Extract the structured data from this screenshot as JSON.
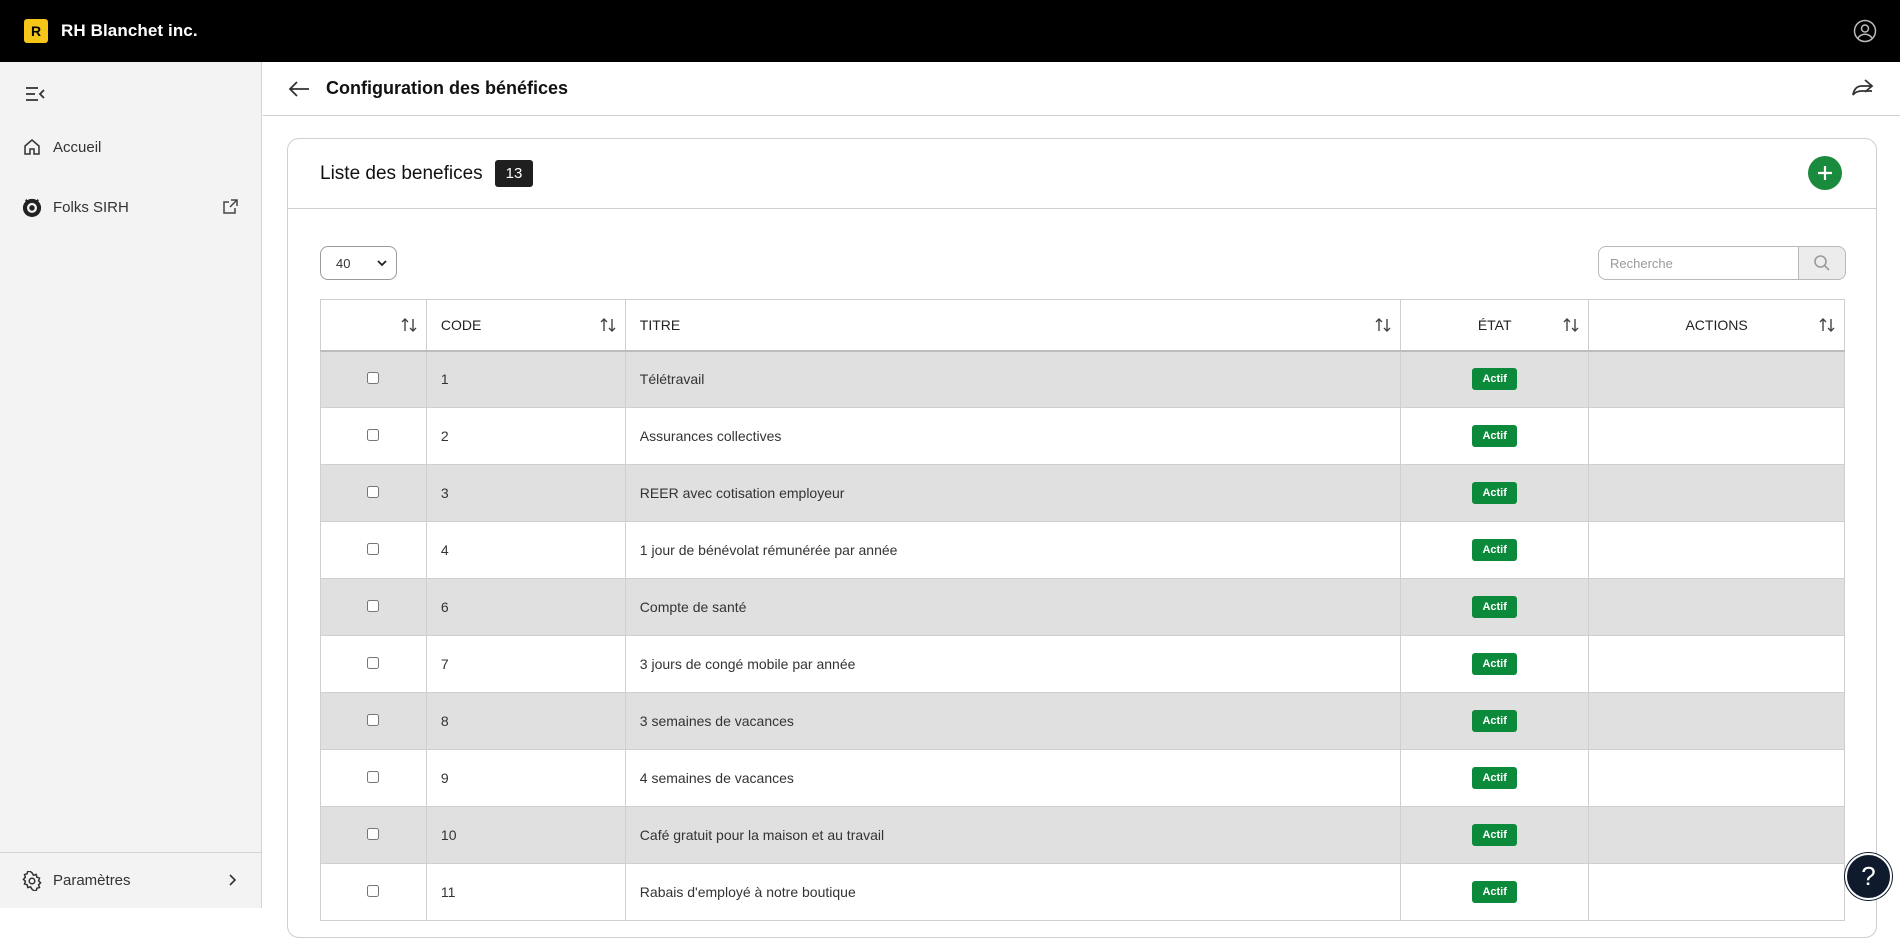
{
  "topbar": {
    "logo_letter": "R",
    "brand_name": "RH Blanchet inc.",
    "icons": {
      "user": "user-circle-icon"
    }
  },
  "sidebar": {
    "collapse_icon": "collapse-menu-icon",
    "items": [
      {
        "label": "Accueil",
        "icon": "home-icon"
      },
      {
        "label": "Folks SIRH",
        "icon": "folks-logo-icon",
        "trailing_icon": "external-link-icon"
      }
    ],
    "footer": {
      "label": "Paramètres",
      "icon": "gear-icon",
      "trailing_icon": "chevron-right-icon"
    }
  },
  "header": {
    "title": "Configuration des bénéfices",
    "back_icon": "arrow-left-icon",
    "share_icon": "share-icon"
  },
  "card": {
    "title": "Liste des benefices",
    "count": "13",
    "add_icon": "plus-icon"
  },
  "controls": {
    "per_page": "40",
    "search_placeholder": "Recherche",
    "search_icon": "search-icon"
  },
  "table": {
    "columns": [
      "",
      "CODE",
      "TITRE",
      "ÉTAT",
      "ACTIONS"
    ],
    "rows": [
      {
        "code": "1",
        "titre": "Télétravail",
        "etat": "Actif"
      },
      {
        "code": "2",
        "titre": "Assurances collectives",
        "etat": "Actif"
      },
      {
        "code": "3",
        "titre": "REER avec cotisation employeur",
        "etat": "Actif"
      },
      {
        "code": "4",
        "titre": "1 jour de bénévolat rémunérée par année",
        "etat": "Actif"
      },
      {
        "code": "6",
        "titre": "Compte de santé",
        "etat": "Actif"
      },
      {
        "code": "7",
        "titre": "3 jours de congé mobile par année",
        "etat": "Actif"
      },
      {
        "code": "8",
        "titre": "3 semaines de vacances",
        "etat": "Actif"
      },
      {
        "code": "9",
        "titre": "4 semaines de vacances",
        "etat": "Actif"
      },
      {
        "code": "10",
        "titre": "Café gratuit pour la maison et au travail",
        "etat": "Actif"
      },
      {
        "code": "11",
        "titre": "Rabais d'employé à notre boutique",
        "etat": "Actif"
      }
    ]
  },
  "help": {
    "label": "?",
    "icon": "help-icon"
  },
  "colors": {
    "accent_green": "#0c8a3b",
    "topbar": "#000000",
    "logo": "#f5c518"
  }
}
